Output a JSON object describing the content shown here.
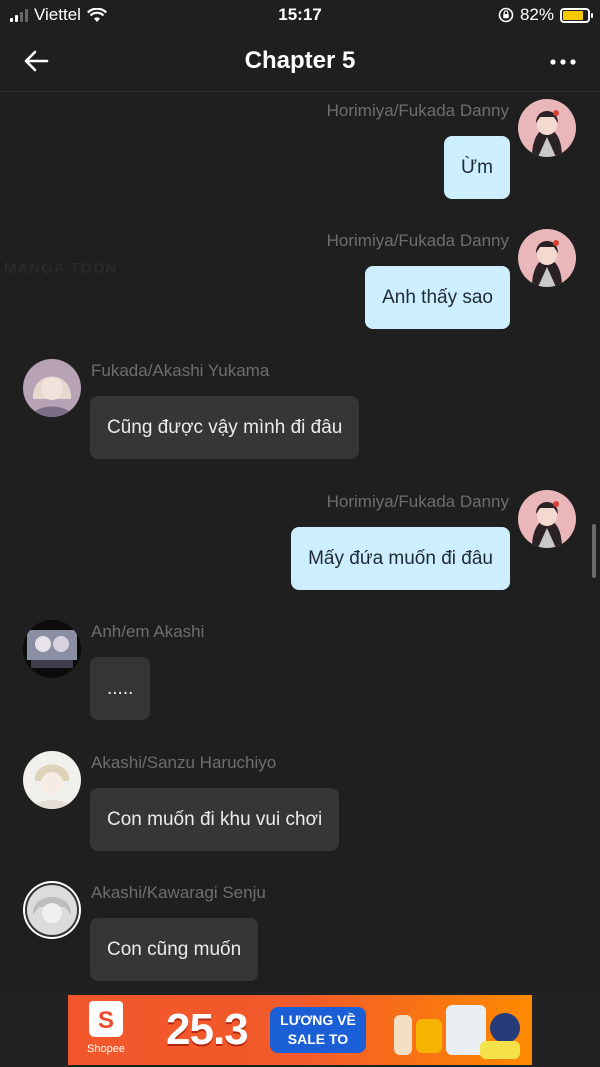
{
  "status_bar": {
    "carrier": "Viettel",
    "time": "15:17",
    "battery": "82%",
    "battery_level": 0.82,
    "battery_color": "#f7c900"
  },
  "nav": {
    "title": "Chapter 5",
    "back_icon": "arrow-left-icon",
    "more_icon": "more-dots-icon"
  },
  "watermark": "MANGA TOON",
  "messages": [
    {
      "side": "right",
      "name": "Horimiya/Fukada Danny",
      "text": "Ừm"
    },
    {
      "side": "right",
      "name": "Horimiya/Fukada Danny",
      "text": "Anh thấy sao"
    },
    {
      "side": "left",
      "name": "Fukada/Akashi Yukama",
      "text": "Cũng được vậy mình đi đâu"
    },
    {
      "side": "right",
      "name": "Horimiya/Fukada Danny",
      "text": "Mấy đứa muốn đi đâu"
    },
    {
      "side": "left",
      "name": "Anh/em Akashi",
      "text": "....."
    },
    {
      "side": "left",
      "name": "Akashi/Sanzu Haruchiyo",
      "text": "Con muốn đi khu vui chơi"
    },
    {
      "side": "left",
      "name": "Akashi/Kawaragi Senju",
      "text": "Con cũng muốn"
    }
  ],
  "ad": {
    "brand": "Shopee",
    "brand_logo": "S",
    "date": "25.3",
    "badge_line1": "LƯƠNG VỀ",
    "badge_line2": "SALE TO",
    "colors": {
      "brand": "#ee4d2d",
      "badge": "#1a5fd6"
    }
  },
  "colors": {
    "background": "#1f1f1f",
    "bubble_self": "#cdeefd",
    "bubble_other": "#363636",
    "name_text": "#6e6e6e"
  }
}
